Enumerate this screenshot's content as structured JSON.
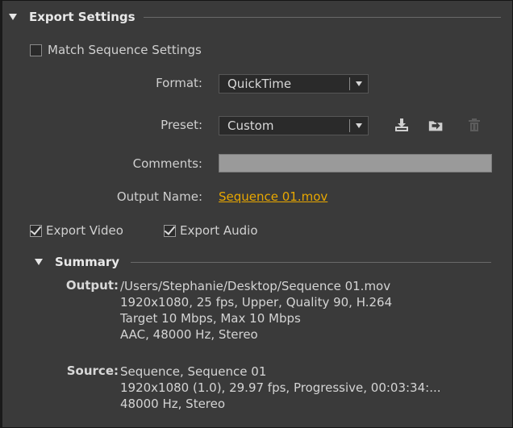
{
  "export_settings": {
    "title": "Export Settings",
    "match_sequence": {
      "label": "Match Sequence Settings",
      "checked": false
    },
    "format": {
      "label": "Format:",
      "value": "QuickTime"
    },
    "preset": {
      "label": "Preset:",
      "value": "Custom"
    },
    "preset_icons": [
      "save-preset-icon",
      "import-preset-icon",
      "delete-preset-icon"
    ],
    "comments": {
      "label": "Comments:",
      "value": ""
    },
    "output_name": {
      "label": "Output Name:",
      "value": "Sequence 01.mov"
    },
    "export_video": {
      "label": "Export Video",
      "checked": true
    },
    "export_audio": {
      "label": "Export Audio",
      "checked": true
    }
  },
  "summary": {
    "title": "Summary",
    "output": {
      "label": "Output:",
      "lines": [
        "/Users/Stephanie/Desktop/Sequence 01.mov",
        "1920x1080, 25 fps, Upper, Quality 90, H.264",
        "Target 10 Mbps, Max 10 Mbps",
        "AAC, 48000 Hz, Stereo"
      ]
    },
    "source": {
      "label": "Source:",
      "lines": [
        "Sequence, Sequence 01",
        "1920x1080 (1.0), 29.97 fps, Progressive, 00:03:34:...",
        "48000 Hz, Stereo"
      ]
    }
  },
  "colors": {
    "panel_bg": "#3a3a3a",
    "link": "#e8a700",
    "text": "#d4d4d4"
  }
}
